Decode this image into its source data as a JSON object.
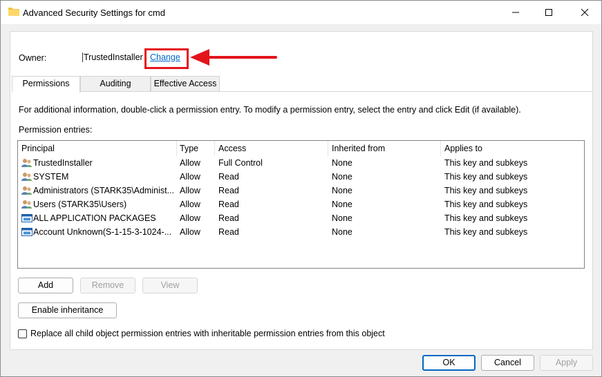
{
  "window": {
    "title": "Advanced Security Settings for cmd",
    "folder_icon": "folder-icon"
  },
  "owner": {
    "label": "Owner:",
    "value": "TrustedInstaller",
    "change_link": "Change"
  },
  "tabs": [
    {
      "label": "Permissions",
      "active": true
    },
    {
      "label": "Auditing",
      "active": false
    },
    {
      "label": "Effective Access",
      "active": false
    }
  ],
  "info_text": "For additional information, double-click a permission entry. To modify a permission entry, select the entry and click Edit (if available).",
  "entries_label": "Permission entries:",
  "columns": [
    "Principal",
    "Type",
    "Access",
    "Inherited from",
    "Applies to"
  ],
  "entries": [
    {
      "icon": "user-group-icon",
      "principal": "TrustedInstaller",
      "type": "Allow",
      "access": "Full Control",
      "inherited": "None",
      "applies": "This key and subkeys"
    },
    {
      "icon": "user-group-icon",
      "principal": "SYSTEM",
      "type": "Allow",
      "access": "Read",
      "inherited": "None",
      "applies": "This key and subkeys"
    },
    {
      "icon": "user-group-icon",
      "principal": "Administrators (STARK35\\Administ...",
      "type": "Allow",
      "access": "Read",
      "inherited": "None",
      "applies": "This key and subkeys"
    },
    {
      "icon": "user-group-icon",
      "principal": "Users (STARK35\\Users)",
      "type": "Allow",
      "access": "Read",
      "inherited": "None",
      "applies": "This key and subkeys"
    },
    {
      "icon": "app-package-icon",
      "principal": "ALL APPLICATION PACKAGES",
      "type": "Allow",
      "access": "Read",
      "inherited": "None",
      "applies": "This key and subkeys"
    },
    {
      "icon": "app-package-icon",
      "principal": "Account Unknown(S-1-15-3-1024-...",
      "type": "Allow",
      "access": "Read",
      "inherited": "None",
      "applies": "This key and subkeys"
    }
  ],
  "buttons": {
    "add": "Add",
    "remove": "Remove",
    "view": "View",
    "enable_inheritance": "Enable inheritance",
    "ok": "OK",
    "cancel": "Cancel",
    "apply": "Apply"
  },
  "replace_checkbox": {
    "label": "Replace all child object permission entries with inheritable permission entries from this object",
    "checked": false
  },
  "colors": {
    "link": "#0066cc",
    "highlight": "#e4141b",
    "accent": "#0067c0"
  }
}
